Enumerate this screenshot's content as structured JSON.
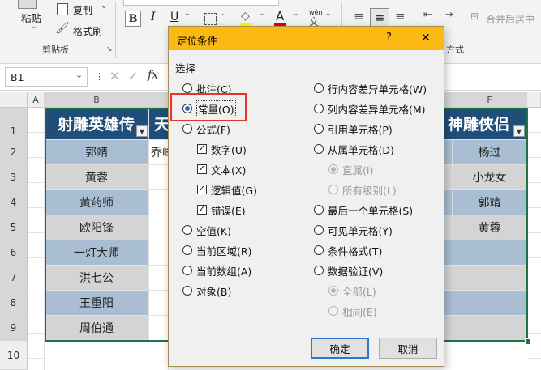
{
  "ribbon": {
    "paste_label": "粘贴",
    "copy_label": "复制",
    "format_painter_label": "格式刷",
    "clipboard_group": "剪贴板",
    "bold": "B",
    "italic": "I",
    "underline": "U",
    "font_color_letter": "A",
    "wen_label": "wén",
    "merge_center_label": "合并后居中",
    "align_group": "方式"
  },
  "formula_bar": {
    "name_box": "B1",
    "fx": "fx"
  },
  "sheet": {
    "columns": [
      "A",
      "B",
      "F"
    ],
    "rows": [
      "1",
      "2",
      "3",
      "4",
      "5",
      "6",
      "7",
      "8",
      "9",
      "10"
    ],
    "header_b": "射雕英雄传",
    "header_c_partial": "天",
    "header_f": "神雕侠侣",
    "col_b": [
      "郭靖",
      "黄蓉",
      "黄药师",
      "欧阳锋",
      "一灯大师",
      "洪七公",
      "王重阳",
      "周伯通"
    ],
    "c2_partial": "乔峰",
    "col_f": [
      "杨过",
      "小龙女",
      "郭靖",
      "黄蓉"
    ]
  },
  "dialog": {
    "title": "定位条件",
    "help": "?",
    "close": "✕",
    "group_label": "选择",
    "left_options": [
      "批注(C)",
      "常量(O)",
      "公式(F)"
    ],
    "sub_checks": [
      "数字(U)",
      "文本(X)",
      "逻辑值(G)",
      "错误(E)"
    ],
    "left_options2": [
      "空值(K)",
      "当前区域(R)",
      "当前数组(A)",
      "对象(B)"
    ],
    "right_options": [
      "行内容差异单元格(W)",
      "列内容差异单元格(M)",
      "引用单元格(P)",
      "从属单元格(D)"
    ],
    "right_sub1": [
      "直属(I)",
      "所有级别(L)"
    ],
    "right_options2": [
      "最后一个单元格(S)",
      "可见单元格(Y)",
      "条件格式(T)",
      "数据验证(V)"
    ],
    "right_sub2": [
      "全部(L)",
      "相同(E)"
    ],
    "ok_label": "确定",
    "cancel_label": "取消",
    "selected": "常量(O)"
  }
}
